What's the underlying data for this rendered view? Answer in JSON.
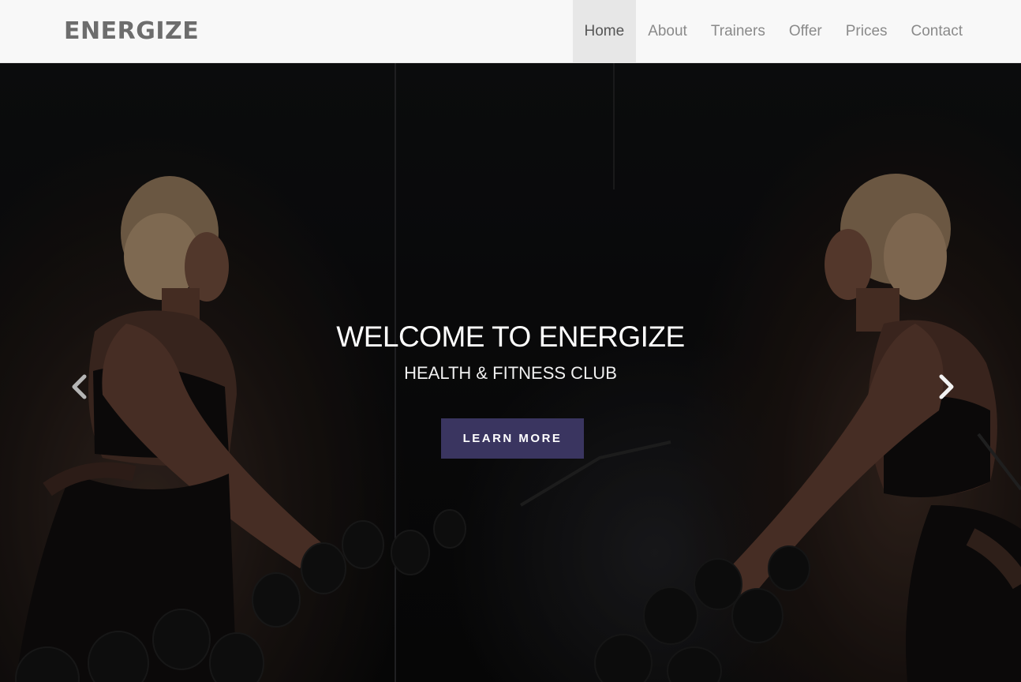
{
  "brand": {
    "name": "ENERGIZE"
  },
  "nav": {
    "items": [
      {
        "label": "Home",
        "active": true
      },
      {
        "label": "About",
        "active": false
      },
      {
        "label": "Trainers",
        "active": false
      },
      {
        "label": "Offer",
        "active": false
      },
      {
        "label": "Prices",
        "active": false
      },
      {
        "label": "Contact",
        "active": false
      }
    ]
  },
  "hero": {
    "title": "WELCOME TO ENERGIZE",
    "subtitle": "HEALTH & FITNESS CLUB",
    "cta_label": "LEARN MORE",
    "prev_icon": "chevron-left-icon",
    "next_icon": "chevron-right-icon",
    "background_image": "woman-lifting-dumbbells-mirror-photo"
  },
  "colors": {
    "navbar_bg": "#f8f8f8",
    "active_nav_bg": "#e7e7e7",
    "brand_text": "#6d6d6d",
    "cta_bg": "#3a3560",
    "hero_text": "#ffffff"
  }
}
